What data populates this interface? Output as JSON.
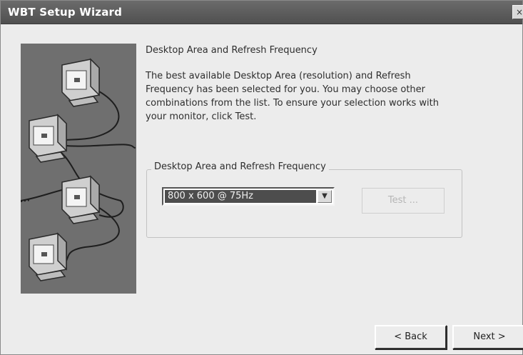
{
  "window": {
    "title": "WBT Setup Wizard",
    "close_glyph": "×"
  },
  "page": {
    "heading": "Desktop Area and Refresh Frequency",
    "description": "The best available Desktop Area (resolution) and Refresh Frequency has been selected for you.  You may choose other combinations from the list.  To ensure your selection works with your monitor, click Test."
  },
  "group": {
    "label": "Desktop Area and Refresh Frequency",
    "selected_value": "800 x 600 @ 75Hz",
    "dropdown_arrow_glyph": "▼",
    "test_label": "Test ..."
  },
  "buttons": {
    "back_label": "< Back",
    "next_label": "Next >"
  },
  "icons": [
    "monitor-icon",
    "network-cable"
  ]
}
